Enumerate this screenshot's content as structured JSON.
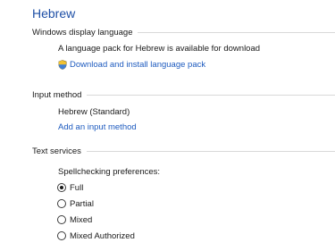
{
  "title": "Hebrew",
  "windows_display_language": {
    "header": "Windows display language",
    "message": "A language pack for Hebrew is available for download",
    "download_link": "Download and install language pack",
    "link_icon": "uac-shield-icon"
  },
  "input_method": {
    "header": "Input method",
    "current": "Hebrew (Standard)",
    "add_link": "Add an input method"
  },
  "text_services": {
    "header": "Text services",
    "spellcheck_label": "Spellchecking preferences:",
    "options": [
      {
        "label": "Full",
        "checked": true
      },
      {
        "label": "Partial",
        "checked": false
      },
      {
        "label": "Mixed",
        "checked": false
      },
      {
        "label": "Mixed Authorized",
        "checked": false
      }
    ]
  },
  "colors": {
    "title": "#1e4fa6",
    "link": "#1e5bbf",
    "rule": "#d9d9d9"
  }
}
